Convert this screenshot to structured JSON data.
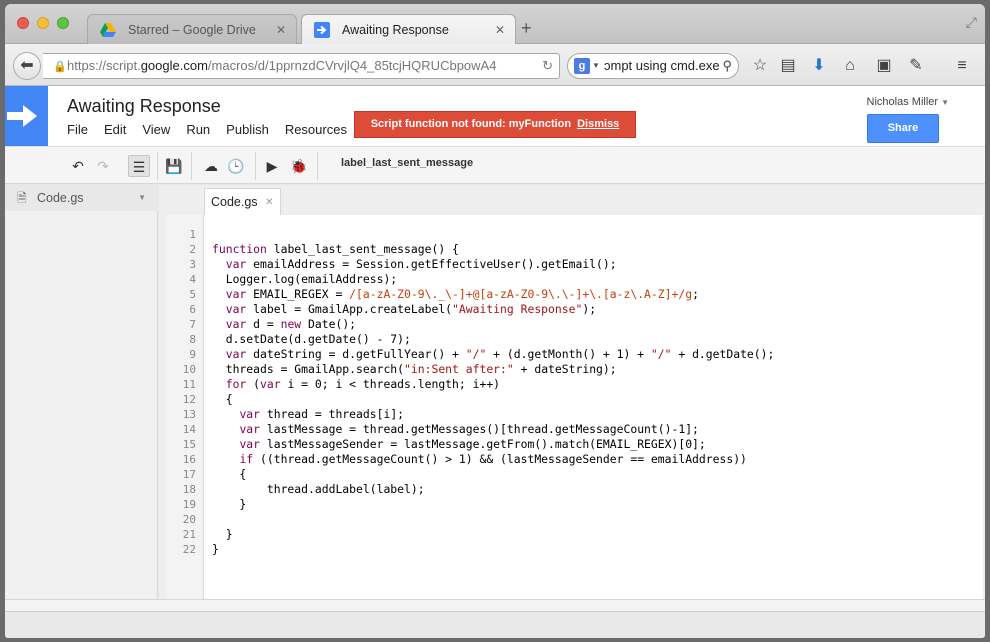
{
  "browser": {
    "tabs": [
      {
        "label": "Starred – Google Drive",
        "active": false
      },
      {
        "label": "Awaiting Response",
        "active": true
      }
    ],
    "new_tab": "+",
    "url_prefix": "https://script.",
    "url_domain": "google.com",
    "url_path": "/macros/d/1pprnzdCVrvjlQ4_85tcjHQRUCbpowA4",
    "search_text": "ɔmpt using cmd.exe"
  },
  "app": {
    "project_title": "Awaiting Response",
    "menu": [
      "File",
      "Edit",
      "View",
      "Run",
      "Publish",
      "Resources"
    ],
    "alert_text": "Script function not found: myFunction",
    "alert_action": "Dismiss",
    "user_name": "Nicholas Miller",
    "share_label": "Share",
    "function_select": "label_last_sent_message",
    "accent_color": "#4285f4",
    "alert_color": "#dd4b39"
  },
  "sidebar": {
    "file": "Code.gs"
  },
  "editor": {
    "tab": "Code.gs",
    "line_numbers": [
      "1",
      "2",
      "3",
      "4",
      "5",
      "6",
      "7",
      "8",
      "9",
      "10",
      "11",
      "12",
      "13",
      "14",
      "15",
      "16",
      "17",
      "18",
      "19",
      "20",
      "21",
      "22"
    ],
    "lines": [
      "",
      "function label_last_sent_message() {",
      "  var emailAddress = Session.getEffectiveUser().getEmail();",
      "  Logger.log(emailAddress);",
      "  var EMAIL_REGEX = /[a-zA-Z0-9\\._\\-]+@[a-zA-Z0-9\\.\\-]+\\.[a-z\\.A-Z]+/g;",
      "  var label = GmailApp.createLabel(\"Awaiting Response\");",
      "  var d = new Date();",
      "  d.setDate(d.getDate() - 7);",
      "  var dateString = d.getFullYear() + \"/\" + (d.getMonth() + 1) + \"/\" + d.getDate();",
      "  threads = GmailApp.search(\"in:Sent after:\" + dateString);",
      "  for (var i = 0; i < threads.length; i++)",
      "  {",
      "    var thread = threads[i];",
      "    var lastMessage = thread.getMessages()[thread.getMessageCount()-1];",
      "    var lastMessageSender = lastMessage.getFrom().match(EMAIL_REGEX)[0];",
      "    if ((thread.getMessageCount() > 1) && (lastMessageSender == emailAddress))",
      "    {",
      "        thread.addLabel(label);",
      "    }",
      "",
      "  }",
      "}"
    ]
  }
}
